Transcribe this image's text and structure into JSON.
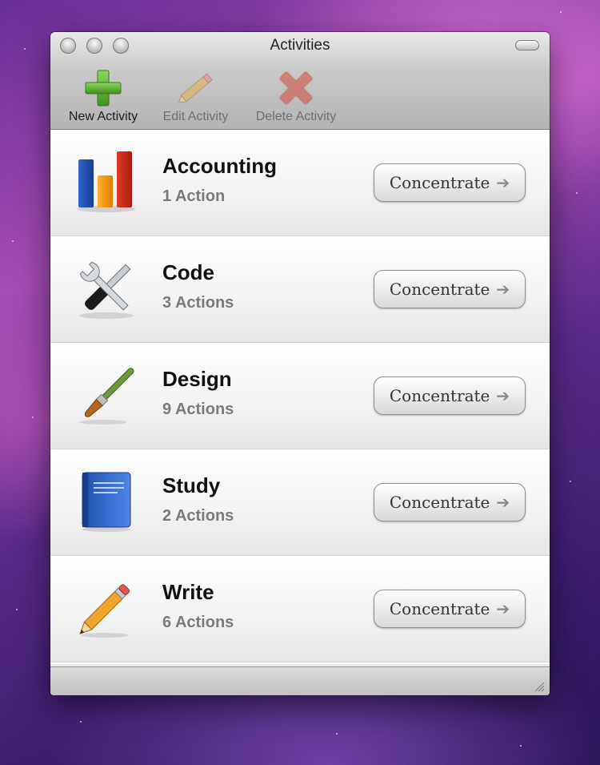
{
  "window": {
    "title": "Activities"
  },
  "toolbar": {
    "new_label": "New Activity",
    "edit_label": "Edit Activity",
    "delete_label": "Delete Activity"
  },
  "activities": [
    {
      "name": "Accounting",
      "count": "1 Action",
      "icon": "bar-chart-icon",
      "button": "Concentrate"
    },
    {
      "name": "Code",
      "count": "3 Actions",
      "icon": "tools-icon",
      "button": "Concentrate"
    },
    {
      "name": "Design",
      "count": "9 Actions",
      "icon": "paintbrush-icon",
      "button": "Concentrate"
    },
    {
      "name": "Study",
      "count": "2 Actions",
      "icon": "book-icon",
      "button": "Concentrate"
    },
    {
      "name": "Write",
      "count": "6 Actions",
      "icon": "pencil-icon",
      "button": "Concentrate"
    }
  ],
  "colors": {
    "accent_green": "#5aa832",
    "delete_red": "#d24a3a"
  }
}
